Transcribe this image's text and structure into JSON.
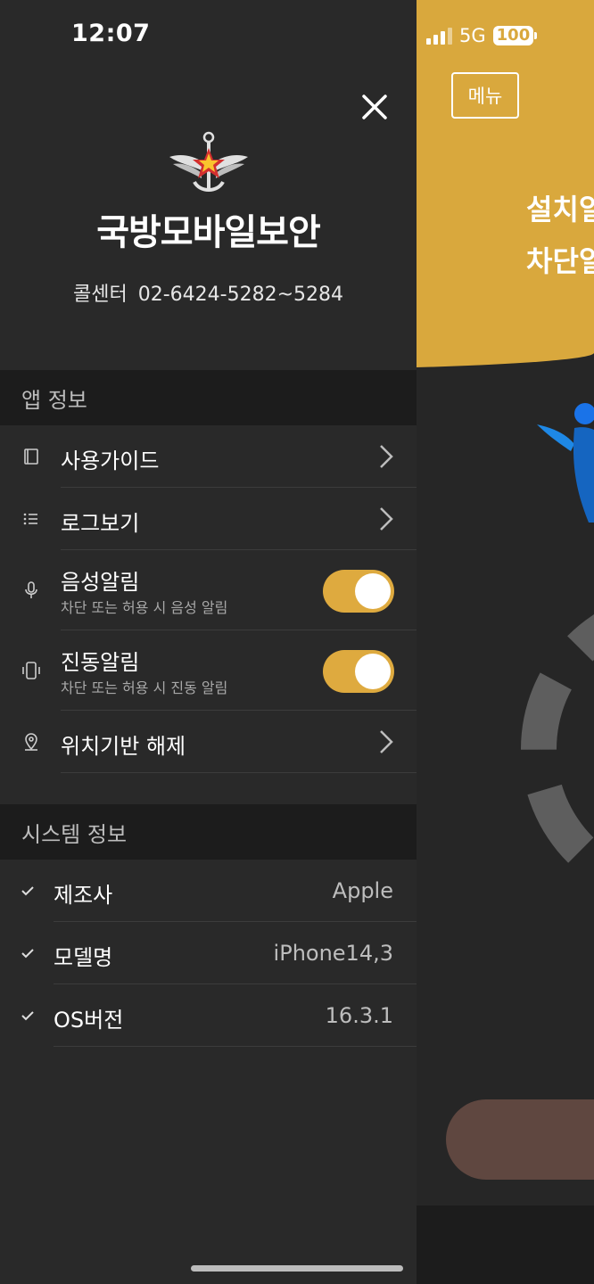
{
  "status_bar": {
    "time": "12:07",
    "network": "5G",
    "battery": "100"
  },
  "background_app": {
    "menu_button": "메뉴",
    "headline_line1": "설치일",
    "headline_line2": "차단일"
  },
  "drawer": {
    "brand": "국방모바일보안",
    "callcenter_label": "콜센터",
    "callcenter_number": "02-6424-5282~5284",
    "app_info": {
      "title": "앱 정보",
      "items": [
        {
          "label": "사용가이드",
          "icon": "book-icon",
          "control": "chevron"
        },
        {
          "label": "로그보기",
          "icon": "list-icon",
          "control": "chevron"
        },
        {
          "label": "음성알림",
          "sub": "차단 또는 허용 시 음성 알림",
          "icon": "microphone-icon",
          "control": "toggle",
          "on": true
        },
        {
          "label": "진동알림",
          "sub": "차단 또는 허용 시 진동 알림",
          "icon": "vibrate-icon",
          "control": "toggle",
          "on": true
        },
        {
          "label": "위치기반 해제",
          "icon": "location-pin-icon",
          "control": "chevron"
        }
      ]
    },
    "system_info": {
      "title": "시스템 정보",
      "items": [
        {
          "label": "제조사",
          "value": "Apple"
        },
        {
          "label": "모델명",
          "value": "iPhone14,3"
        },
        {
          "label": "OS버전",
          "value": "16.3.1"
        }
      ]
    }
  },
  "colors": {
    "accent": "#deaa3f",
    "drawer_bg": "#292929",
    "section_bg": "#1c1c1c",
    "banner": "#d9a83d"
  }
}
